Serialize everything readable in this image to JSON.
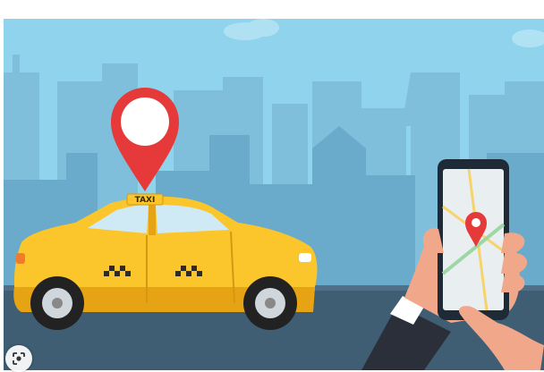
{
  "image": {
    "roof_sign_text": "TAXI",
    "colors": {
      "sky": "#8fd3ec",
      "buildings_far": "#7fbfdc",
      "buildings_mid": "#6fb0d0",
      "ground": "#3f5e74",
      "taxi_yellow": "#fbc52c",
      "taxi_shadow": "#e6a415",
      "pin_red": "#e63a3a",
      "phone_dark": "#1e2a35",
      "hand_skin": "#f1a88a",
      "sleeve": "#2b2f3a"
    }
  },
  "overlay": {
    "lens_icon": "visual-search-icon"
  }
}
